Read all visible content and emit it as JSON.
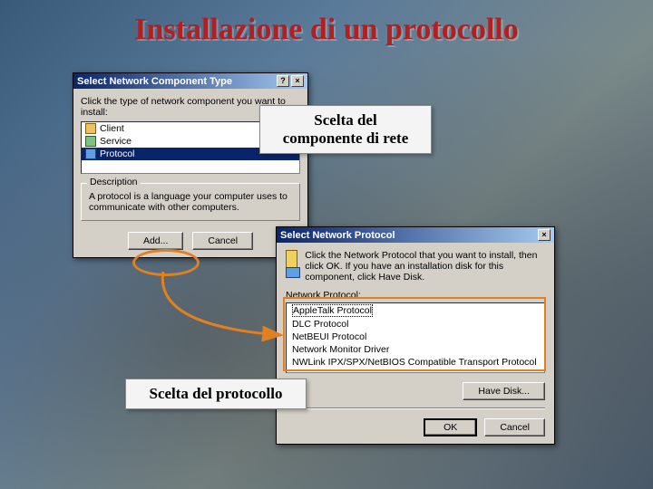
{
  "slide_title": "Installazione di un protocollo",
  "callout1": "Scelta del componente di rete",
  "callout2": "Scelta del protocollo",
  "dialog1": {
    "title": "Select Network Component Type",
    "instruction": "Click the type of network component you want to install:",
    "items": [
      "Client",
      "Service",
      "Protocol"
    ],
    "selected": "Protocol",
    "desc_legend": "Description",
    "desc_text": "A protocol is a language your computer uses to communicate with other computers.",
    "add_btn": "Add...",
    "cancel_btn": "Cancel"
  },
  "dialog2": {
    "title": "Select Network Protocol",
    "instruction": "Click the Network Protocol that you want to install, then click OK. If you have an installation disk for this component, click Have Disk.",
    "list_label": "Network Protocol:",
    "items": [
      "AppleTalk Protocol",
      "DLC Protocol",
      "NetBEUI Protocol",
      "Network Monitor Driver",
      "NWLink IPX/SPX/NetBIOS Compatible Transport Protocol"
    ],
    "selected": "AppleTalk Protocol",
    "havedisk_btn": "Have Disk...",
    "ok_btn": "OK",
    "cancel_btn": "Cancel"
  }
}
